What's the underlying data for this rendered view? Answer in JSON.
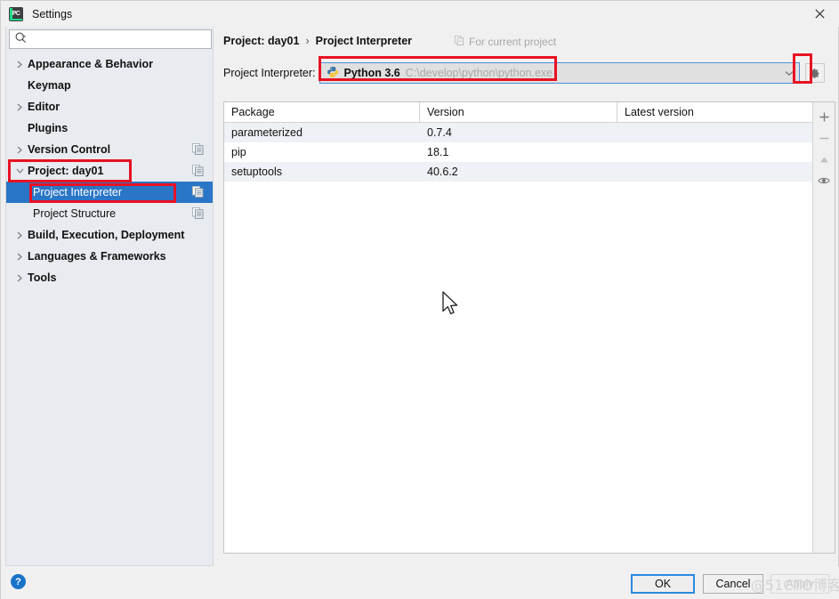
{
  "window": {
    "title": "Settings",
    "app_icon": "pycharm-icon",
    "close_icon": "close-icon"
  },
  "search": {
    "placeholder": "",
    "value": "",
    "icon": "search-icon"
  },
  "sidebar": {
    "items": [
      {
        "label": "Appearance & Behavior",
        "level": 0,
        "arrow": "chevron-right",
        "selected": false,
        "copy_icon": false
      },
      {
        "label": "Keymap",
        "level": 0,
        "arrow": "none",
        "selected": false,
        "copy_icon": false
      },
      {
        "label": "Editor",
        "level": 0,
        "arrow": "chevron-right",
        "selected": false,
        "copy_icon": false
      },
      {
        "label": "Plugins",
        "level": 0,
        "arrow": "none",
        "selected": false,
        "copy_icon": false
      },
      {
        "label": "Version Control",
        "level": 0,
        "arrow": "chevron-right",
        "selected": false,
        "copy_icon": true
      },
      {
        "label": "Project: day01",
        "level": 0,
        "arrow": "chevron-down",
        "selected": false,
        "copy_icon": true
      },
      {
        "label": "Project Interpreter",
        "level": 1,
        "arrow": "none",
        "selected": true,
        "copy_icon": true
      },
      {
        "label": "Project Structure",
        "level": 1,
        "arrow": "none",
        "selected": false,
        "copy_icon": true
      },
      {
        "label": "Build, Execution, Deployment",
        "level": 0,
        "arrow": "chevron-right",
        "selected": false,
        "copy_icon": false
      },
      {
        "label": "Languages & Frameworks",
        "level": 0,
        "arrow": "chevron-right",
        "selected": false,
        "copy_icon": false
      },
      {
        "label": "Tools",
        "level": 0,
        "arrow": "chevron-right",
        "selected": false,
        "copy_icon": false
      }
    ]
  },
  "content": {
    "breadcrumb": {
      "parent": "Project: day01",
      "separator": "›",
      "current": "Project Interpreter"
    },
    "scope_note": {
      "icon": "copy-icon",
      "text": "For current project"
    },
    "interpreter": {
      "label": "Project Interpreter:",
      "icon": "python-icon",
      "name": "Python 3.6",
      "path": "C:\\develop\\python\\python.exe",
      "dropdown_icon": "chevron-down-icon",
      "settings_icon": "gear-icon"
    },
    "packages": {
      "columns": [
        "Package",
        "Version",
        "Latest version"
      ],
      "rows": [
        {
          "package": "parameterized",
          "version": "0.7.4",
          "latest": ""
        },
        {
          "package": "pip",
          "version": "18.1",
          "latest": ""
        },
        {
          "package": "setuptools",
          "version": "40.6.2",
          "latest": ""
        }
      ],
      "tools": [
        {
          "icon": "plus-icon",
          "name": "add-package-button"
        },
        {
          "icon": "minus-icon",
          "name": "remove-package-button"
        },
        {
          "icon": "upgrade-icon",
          "name": "upgrade-package-button"
        },
        {
          "icon": "eye-icon",
          "name": "show-early-releases-button"
        }
      ]
    }
  },
  "footer": {
    "help_label": "?",
    "ok_label": "OK",
    "cancel_label": "Cancel",
    "apply_label": "Apply"
  },
  "watermark": {
    "text": "@51CTO博客"
  },
  "colors": {
    "selection_blue": "#2a76c6",
    "annotation_red": "#e81123",
    "accent_blue": "#4a90d9",
    "row_stripe": "#eef1f5",
    "help_blue": "#1a73c8"
  },
  "annotations": [
    {
      "name": "project-day01-highlight"
    },
    {
      "name": "project-interpreter-highlight"
    },
    {
      "name": "interpreter-combo-highlight"
    },
    {
      "name": "combo-arrow-highlight"
    }
  ]
}
